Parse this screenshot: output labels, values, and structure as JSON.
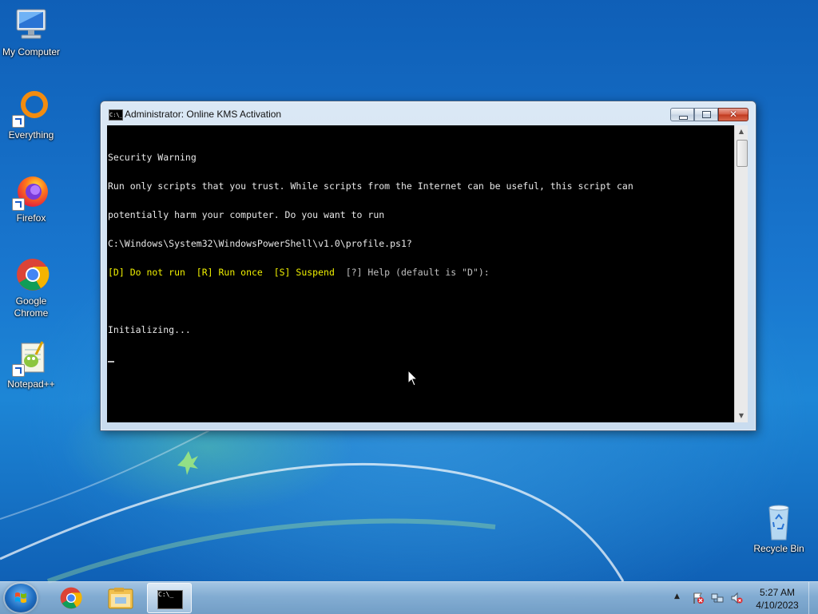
{
  "desktop": {
    "icons": [
      {
        "label": "My Computer",
        "icon": "computer-icon"
      },
      {
        "label": "Everything",
        "icon": "everything-icon"
      },
      {
        "label": "Firefox",
        "icon": "firefox-icon"
      },
      {
        "label": "Google Chrome",
        "icon": "chrome-icon"
      },
      {
        "label": "Notepad++",
        "icon": "notepadpp-icon"
      },
      {
        "label": "Recycle Bin",
        "icon": "recycle-bin-icon"
      }
    ]
  },
  "window": {
    "title": "Administrator:  Online KMS Activation",
    "title_icon_text": "C:\\_",
    "close_glyph": "✕",
    "console_lines": [
      {
        "text": "Security Warning",
        "color": "white"
      },
      {
        "text": "Run only scripts that you trust. While scripts from the Internet can be useful, this script can",
        "color": "white"
      },
      {
        "text": "potentially harm your computer. Do you want to run",
        "color": "white"
      },
      {
        "text": "C:\\Windows\\System32\\WindowsPowerShell\\v1.0\\profile.ps1?",
        "color": "white"
      },
      {
        "prompt_yellow": "[D] Do not run  [R] Run once  [S] Suspend",
        "prompt_rest": "  [?] Help (default is \"D\"):"
      },
      {
        "text": "",
        "color": "white"
      },
      {
        "text": "Initializing...",
        "color": "white"
      }
    ]
  },
  "taskbar": {
    "items": [
      {
        "name": "chrome",
        "icon": "chrome-icon"
      },
      {
        "name": "file-explorer",
        "icon": "folder-icon"
      },
      {
        "name": "command-prompt",
        "icon": "cmd-icon",
        "active": true
      }
    ],
    "tray": {
      "show_hidden_glyph": "▲",
      "icons": [
        "action-center-flag-icon",
        "network-icon",
        "volume-muted-icon"
      ]
    },
    "clock": {
      "time": "5:27 AM",
      "date": "4/10/2023"
    }
  },
  "colors": {
    "console_bg": "#000000",
    "console_text": "#c0c0c0",
    "console_yellow": "#f0f000",
    "close_red": "#c0391f"
  }
}
